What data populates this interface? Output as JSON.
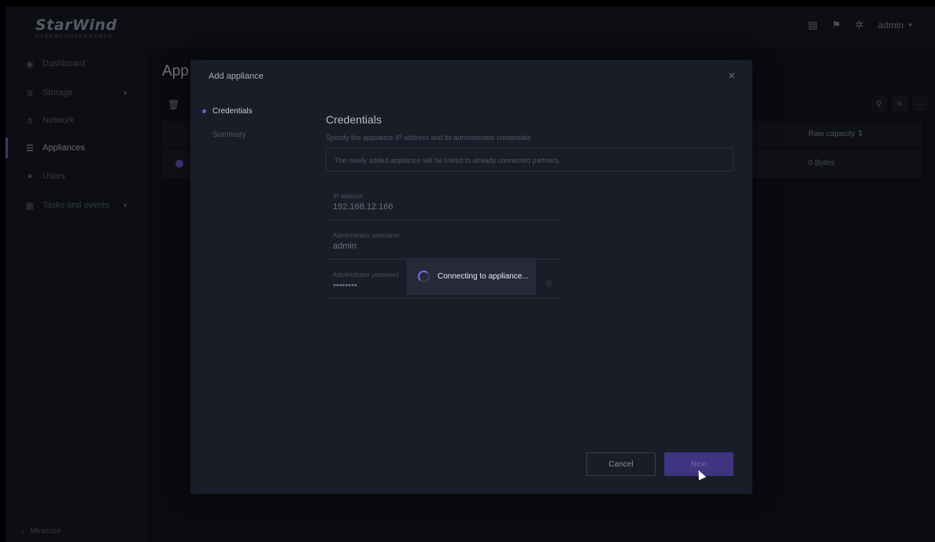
{
  "app": {
    "logo_main": "StarWind",
    "logo_sub": "HYPERCONVERGENCE"
  },
  "topbar": {
    "icons": [
      "document-icon",
      "bell-icon",
      "gear-icon"
    ],
    "user": "admin",
    "user_caret": "▼"
  },
  "sidebar": {
    "items": [
      {
        "label": "Dashboard",
        "icon": "dashboard-icon"
      },
      {
        "label": "Storage",
        "icon": "storage-icon",
        "expandable": true
      },
      {
        "label": "Network",
        "icon": "network-icon"
      },
      {
        "label": "Appliances",
        "icon": "appliances-icon",
        "active": true
      },
      {
        "label": "Users",
        "icon": "users-icon"
      },
      {
        "label": "Tasks and events",
        "icon": "tasks-icon",
        "expandable": true
      }
    ],
    "minimize": "Minimize",
    "minimize_icon": "‹"
  },
  "page": {
    "title": "App",
    "table": {
      "col_raw_capacity": "Raw capacity",
      "sort_glyph": "⇕",
      "row_raw_capacity": "0 Bytes"
    }
  },
  "modal": {
    "title": "Add appliance",
    "close": "×",
    "steps": [
      {
        "label": "Credentials",
        "active": true
      },
      {
        "label": "Summary",
        "active": false
      }
    ],
    "section_title": "Credentials",
    "section_desc": "Specify the appliance IP address and its administrator credentials",
    "info_text": "The newly added appliance will be linked to already connected partners.",
    "fields": {
      "ip_label": "IP address",
      "ip_value": "192.168.12.166",
      "username_label": "Administrator username",
      "username_value": "admin",
      "password_label": "Administrator password",
      "password_value": "••••••••"
    },
    "loading_text": "Connecting to appliance...",
    "cancel_label": "Cancel",
    "next_label": "Next"
  },
  "colors": {
    "accent": "#6d5fd8",
    "modal_bg": "#1a1d27",
    "page_bg": "#13151d"
  }
}
